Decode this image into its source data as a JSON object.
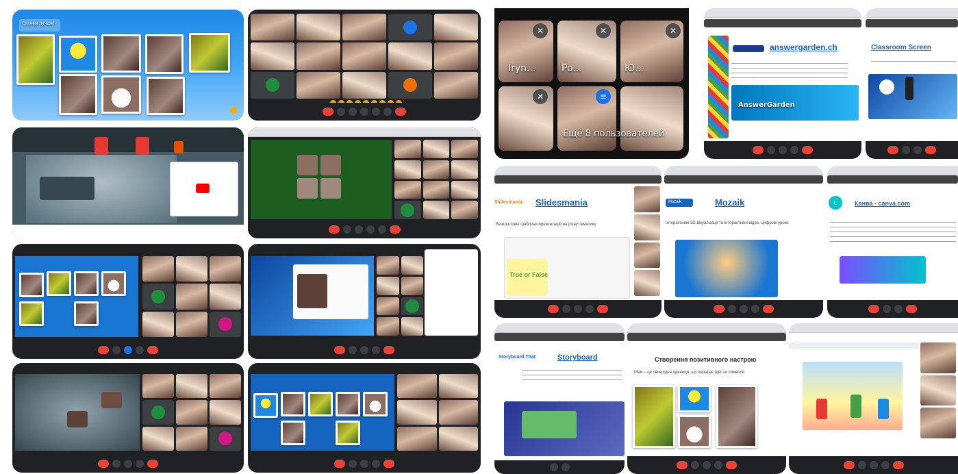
{
  "colors": {
    "meet_dark": "#202124",
    "meet_red": "#ea4335",
    "meet_blue": "#1a73e8",
    "reaction_yellow": "#f9ab00",
    "site_blue": "#1565c0"
  },
  "icons": {
    "mic_off": "mic-off-icon",
    "end_call": "end-call-icon",
    "reaction": "reaction-icon"
  },
  "collage": {
    "tile_a": {
      "header_title": "Станем лучше!"
    },
    "tile_k": {
      "participant_names": [
        "Iryn...",
        "Po...",
        "Ю..."
      ],
      "more_participants": "Ещё 8 пользователей"
    },
    "tile_l": {
      "site": "answergarden.ch",
      "banner": "AnswerGarden"
    },
    "tile_m": {
      "site": "Classroom Screen"
    },
    "tile_n": {
      "logo": "Slidesmania",
      "site": "Slidesmania",
      "text": "Безкоштовні шаблони презентацій на різну тематику",
      "card": "True or False"
    },
    "tile_o": {
      "logo": "Mozaik",
      "site": "Mozaik",
      "text": "Інтерактивні 3D-візуалізації та інтерактивні відео, цифрові уроки"
    },
    "tile_p": {
      "logo": "C",
      "site": "Канва - canva.com"
    },
    "tile_q": {
      "logo": "Storyboard That",
      "site": "Storyboard"
    },
    "tile_r": {
      "heading": "Створення позитивного настрою",
      "subtext": "Мем – це своєрідна одиниця, що передає ідеї чи символи"
    },
    "tile_s": {}
  }
}
